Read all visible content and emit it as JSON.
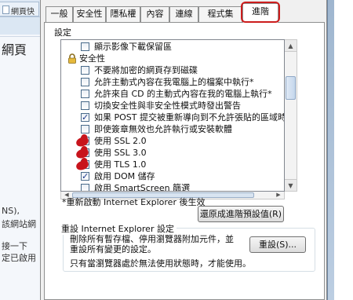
{
  "background_window": {
    "tab_title": "網頁快",
    "heading": "網頁",
    "line1": "NS),",
    "line2": "該網站網",
    "line3": "接一下",
    "line4": "定已啟用"
  },
  "tabs": [
    {
      "label": "一般"
    },
    {
      "label": "安全性"
    },
    {
      "label": "隱私權"
    },
    {
      "label": "內容"
    },
    {
      "label": "連線"
    },
    {
      "label": "程式集"
    },
    {
      "label": "進階"
    }
  ],
  "active_tab": "進階",
  "highlight_color": "#cc1d1d",
  "settings_label": "設定",
  "settings_list": [
    {
      "type": "checkbox",
      "label": "顯示影像下載保留區",
      "checked": false
    },
    {
      "type": "category",
      "label": "安全性",
      "icon": "lock-icon"
    },
    {
      "type": "checkbox",
      "label": "不要將加密的網頁存到磁碟",
      "checked": false
    },
    {
      "type": "checkbox",
      "label": "允許主動式內容在我電腦上的檔案中執行*",
      "checked": false
    },
    {
      "type": "checkbox",
      "label": "允許來自 CD 的主動式內容在我的電腦上執行*",
      "checked": false
    },
    {
      "type": "checkbox",
      "label": "切換安全性與非安全性模式時發出警告",
      "checked": false
    },
    {
      "type": "checkbox",
      "label": "如果 POST 提交被重新導向到不允許張貼的區域時發出",
      "checked": true
    },
    {
      "type": "checkbox",
      "label": "即使簽章無效也允許執行或安裝軟體",
      "checked": false
    },
    {
      "type": "checkbox",
      "label": "使用 SSL 2.0",
      "checked": true,
      "marked": true
    },
    {
      "type": "checkbox",
      "label": "使用 SSL 3.0",
      "checked": true,
      "marked": true
    },
    {
      "type": "checkbox",
      "label": "使用 TLS 1.0",
      "checked": true,
      "marked": true
    },
    {
      "type": "checkbox",
      "label": "啟用 DOM 儲存",
      "checked": true
    },
    {
      "type": "checkbox",
      "label": "啟用 SmartScreen 篩選",
      "checked": false
    }
  ],
  "restart_note": "*重新啟動 Internet Explorer 後生效",
  "restore_button": "還原成進階預設值(R)",
  "reset_group": {
    "title": "重設 Internet Explorer 設定",
    "description": "刪除所有暫存檔、停用瀏覽器附加元件，並重設所有變更的設定。",
    "button": "重設(S)...",
    "note": "只有當瀏覽器處於無法使用狀態時，才能使用。"
  }
}
